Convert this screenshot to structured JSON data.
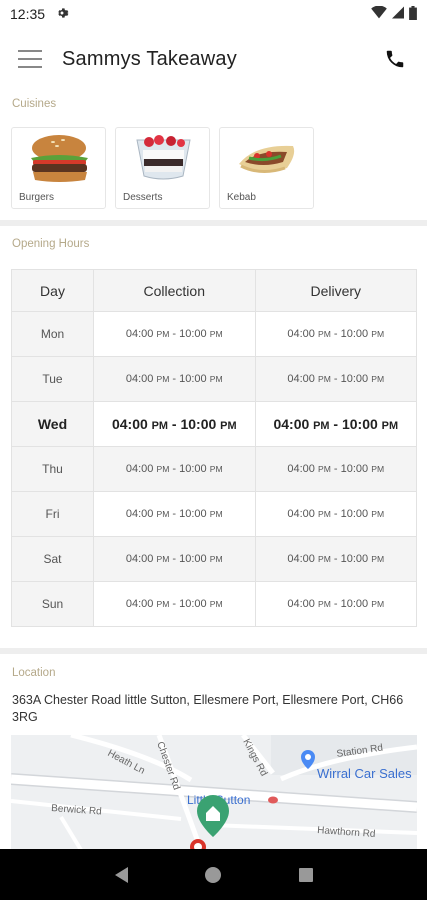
{
  "status_bar": {
    "time": "12:35"
  },
  "header": {
    "title": "Sammys Takeaway"
  },
  "cuisines": {
    "label": "Cuisines",
    "items": [
      {
        "name": "Burgers",
        "icon": "burger-image"
      },
      {
        "name": "Desserts",
        "icon": "dessert-image"
      },
      {
        "name": "Kebab",
        "icon": "kebab-image"
      }
    ]
  },
  "opening_hours": {
    "label": "Opening Hours",
    "headers": [
      "Day",
      "Collection",
      "Delivery"
    ],
    "rows": [
      {
        "day": "Mon",
        "collection_start": "04:00",
        "collection_end": "10:00",
        "delivery_start": "04:00",
        "delivery_end": "10:00",
        "meridiem": "PM"
      },
      {
        "day": "Tue",
        "collection_start": "04:00",
        "collection_end": "10:00",
        "delivery_start": "04:00",
        "delivery_end": "10:00",
        "meridiem": "PM"
      },
      {
        "day": "Wed",
        "collection_start": "04:00",
        "collection_end": "10:00",
        "delivery_start": "04:00",
        "delivery_end": "10:00",
        "meridiem": "PM"
      },
      {
        "day": "Thu",
        "collection_start": "04:00",
        "collection_end": "10:00",
        "delivery_start": "04:00",
        "delivery_end": "10:00",
        "meridiem": "PM"
      },
      {
        "day": "Fri",
        "collection_start": "04:00",
        "collection_end": "10:00",
        "delivery_start": "04:00",
        "delivery_end": "10:00",
        "meridiem": "PM"
      },
      {
        "day": "Sat",
        "collection_start": "04:00",
        "collection_end": "10:00",
        "delivery_start": "04:00",
        "delivery_end": "10:00",
        "meridiem": "PM"
      },
      {
        "day": "Sun",
        "collection_start": "04:00",
        "collection_end": "10:00",
        "delivery_start": "04:00",
        "delivery_end": "10:00",
        "meridiem": "PM"
      }
    ],
    "highlighted_day": "Wed",
    "separator": "-"
  },
  "location": {
    "label": "Location",
    "address": "363A Chester Road little Sutton, Ellesmere Port, Ellesmere Port, CH66 3RG",
    "map": {
      "labels": {
        "heath_ln": "Heath Ln",
        "chester_rd": "Chester Rd",
        "kings_rd": "Kings Rd",
        "station_rd": "Station Rd",
        "wirral_car_sales": "Wirral Car Sales",
        "berwick_rd": "Berwick Rd",
        "little_sutton": "Little Sutton",
        "hawthorn_rd": "Hawthorn Rd"
      }
    }
  },
  "colors": {
    "section_label": "#b5a98a",
    "divider": "#eeeeee",
    "table_border": "#e2e2e2",
    "map_pin": "#3aa272",
    "poi_pin": "#4a8af4",
    "nav_bar": "#000000"
  }
}
